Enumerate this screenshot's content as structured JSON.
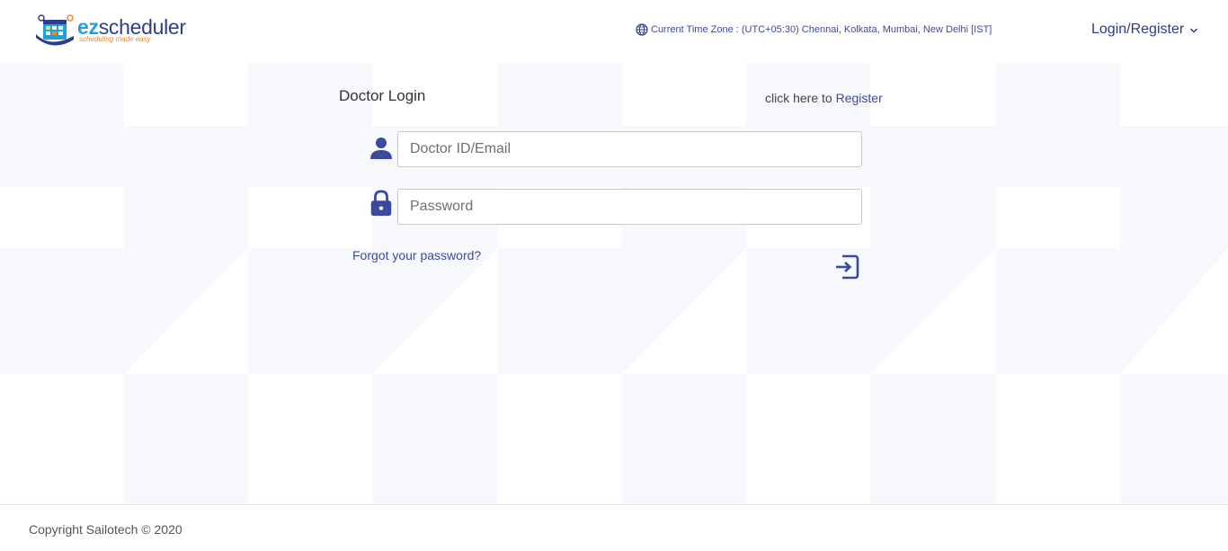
{
  "brand": {
    "logo_ez": "ez",
    "logo_rest": "scheduler",
    "tagline": "scheduling made easy"
  },
  "header": {
    "timezone": "Current Time Zone : (UTC+05:30) Chennai, Kolkata, Mumbai, New Delhi [IST]",
    "login_menu": "Login/Register"
  },
  "login": {
    "title": "Doctor Login",
    "register_prefix": "click here to",
    "register_link": "Register",
    "id_placeholder": "Doctor ID/Email",
    "id_value": "",
    "password_placeholder": "Password",
    "password_value": "",
    "forgot_link": "Forgot your password?"
  },
  "footer": {
    "copyright": "Copyright Sailotech © 2020"
  },
  "icons": {
    "globe": "globe-icon",
    "chevron": "chevron-down-icon",
    "user": "user-icon",
    "lock": "lock-icon",
    "submit": "sign-in-icon"
  },
  "colors": {
    "accent": "#3c4a9e",
    "brand_blue": "#2c3e8c",
    "brand_cyan": "#1fa1dc",
    "brand_orange": "#f08a24",
    "background_tile": "#f7f8fc"
  }
}
